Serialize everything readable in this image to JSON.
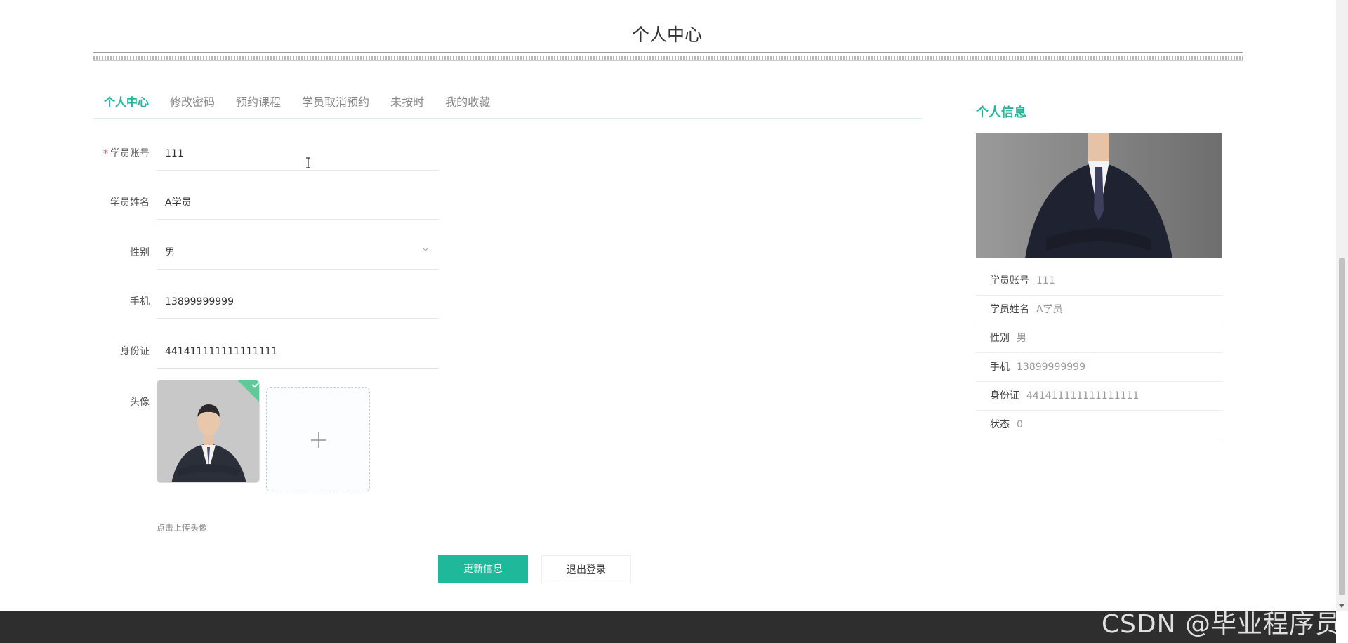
{
  "page": {
    "title": "个人中心"
  },
  "tabs": [
    {
      "label": "个人中心",
      "active": true
    },
    {
      "label": "修改密码",
      "active": false
    },
    {
      "label": "预约课程",
      "active": false
    },
    {
      "label": "学员取消预约",
      "active": false
    },
    {
      "label": "未按时",
      "active": false
    },
    {
      "label": "我的收藏",
      "active": false
    }
  ],
  "form": {
    "account": {
      "label": "学员账号",
      "required": true,
      "value": "111"
    },
    "name": {
      "label": "学员姓名",
      "value": "A学员"
    },
    "gender": {
      "label": "性别",
      "value": "男"
    },
    "phone": {
      "label": "手机",
      "value": "13899999999"
    },
    "idcard": {
      "label": "身份证",
      "value": "441411111111111111"
    },
    "avatar": {
      "label": "头像",
      "hint": "点击上传头像"
    }
  },
  "buttons": {
    "update": "更新信息",
    "logout": "退出登录"
  },
  "info_panel": {
    "title": "个人信息",
    "items": [
      {
        "key": "学员账号",
        "value": "111"
      },
      {
        "key": "学员姓名",
        "value": "A学员"
      },
      {
        "key": "性别",
        "value": "男"
      },
      {
        "key": "手机",
        "value": "13899999999"
      },
      {
        "key": "身份证",
        "value": "441411111111111111"
      },
      {
        "key": "状态",
        "value": "0"
      }
    ]
  },
  "watermark": "CSDN @毕业程序员",
  "colors": {
    "accent": "#1fb89a",
    "footer": "#2e2e2e",
    "required": "#e35b5b"
  }
}
